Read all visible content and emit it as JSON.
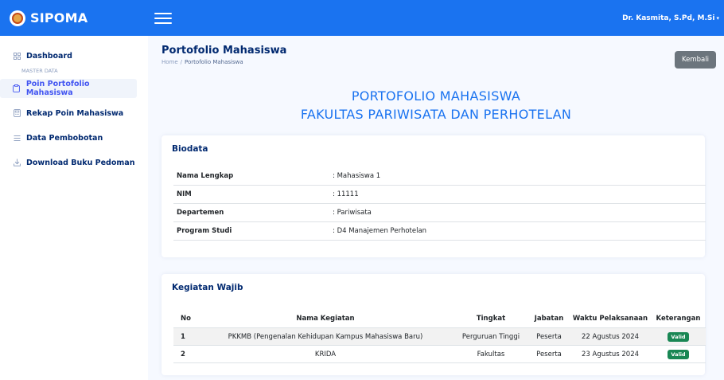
{
  "app": {
    "brand": "SIPOMA",
    "user": "Dr. Kasmita, S.Pd, M.Si"
  },
  "sidebar": {
    "dashboard": "Dashboard",
    "heading": "MASTER DATA",
    "items": [
      {
        "label": "Poin Portofolio Mahasiswa",
        "icon": "clipboard-icon"
      },
      {
        "label": "Rekap Poin Mahasiswa",
        "icon": "calculator-icon"
      },
      {
        "label": "Data Pembobotan",
        "icon": "list-icon"
      },
      {
        "label": "Download Buku Pedoman",
        "icon": "download-icon"
      }
    ]
  },
  "page": {
    "title": "Portofolio Mahasiswa",
    "breadcrumb": {
      "home": "Home",
      "sep": "/",
      "current": "Portofolio Mahasiswa"
    },
    "back_label": "Kembali",
    "heading_line1": "PORTOFOLIO MAHASISWA",
    "heading_line2": "FAKULTAS PARIWISATA DAN PERHOTELAN"
  },
  "biodata": {
    "title": "Biodata",
    "rows": [
      {
        "key": "Nama Lengkap",
        "value": ": Mahasiswa 1"
      },
      {
        "key": "NIM",
        "value": ": 11111"
      },
      {
        "key": "Departemen",
        "value": ": Pariwisata"
      },
      {
        "key": "Program Studi",
        "value": ": D4 Manajemen Perhotelan"
      }
    ]
  },
  "kegiatan": {
    "title": "Kegiatan Wajib",
    "columns": [
      "No",
      "Nama Kegiatan",
      "Tingkat",
      "Jabatan",
      "Waktu Pelaksanaan",
      "Keterangan"
    ],
    "rows": [
      {
        "no": "1",
        "nama": "PKKMB (Pengenalan Kehidupan Kampus Mahasiswa Baru)",
        "tingkat": "Perguruan Tinggi",
        "jabatan": "Peserta",
        "waktu": "22 Agustus 2024",
        "ket": "Valid"
      },
      {
        "no": "2",
        "nama": "KRIDA",
        "tingkat": "Fakultas",
        "jabatan": "Peserta",
        "waktu": "23 Agustus 2024",
        "ket": "Valid"
      }
    ]
  },
  "colors": {
    "topbar": "#1a73f0",
    "accent": "#4154f1",
    "valid": "#198754",
    "back_button": "#6c757d"
  }
}
